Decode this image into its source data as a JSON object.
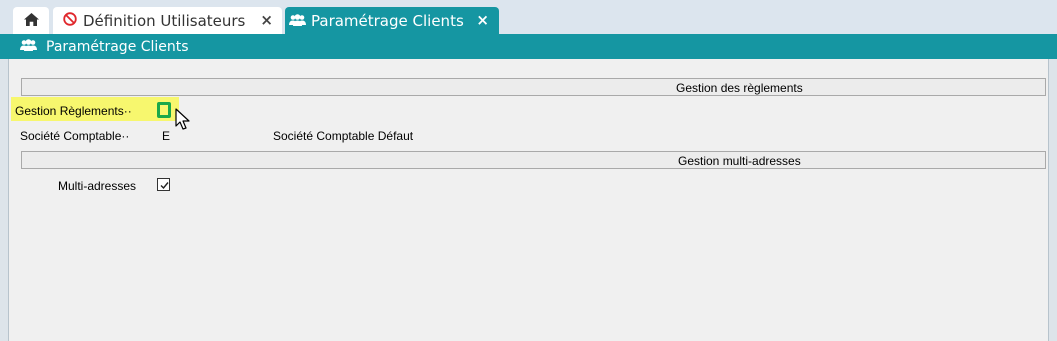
{
  "tabs": [
    {
      "label": "",
      "icon": "home-icon"
    },
    {
      "label": "Définition Utilisateurs",
      "icon": "forbidden-icon",
      "close": "×"
    },
    {
      "label": "Paramétrage Clients",
      "icon": "users-icon",
      "close": "×",
      "active": true
    }
  ],
  "title_bar": {
    "label": "Paramétrage Clients",
    "icon": "users-icon"
  },
  "sections": {
    "reglements": {
      "header": "Gestion des règlements",
      "gestion_label": "Gestion Règlements··",
      "gestion_checked": false,
      "societe_label": "Société Comptable··",
      "societe_value": "E",
      "societe_desc": "Société Comptable Défaut"
    },
    "multi": {
      "header": "Gestion multi-adresses",
      "multi_label": "Multi-adresses",
      "multi_checked": true
    }
  },
  "colors": {
    "accent": "#1596a2",
    "highlight": "#f7f76e",
    "checkbox_green": "#1aa84a",
    "tab_bar": "#dce5ee",
    "panel": "#f0f0f0"
  }
}
